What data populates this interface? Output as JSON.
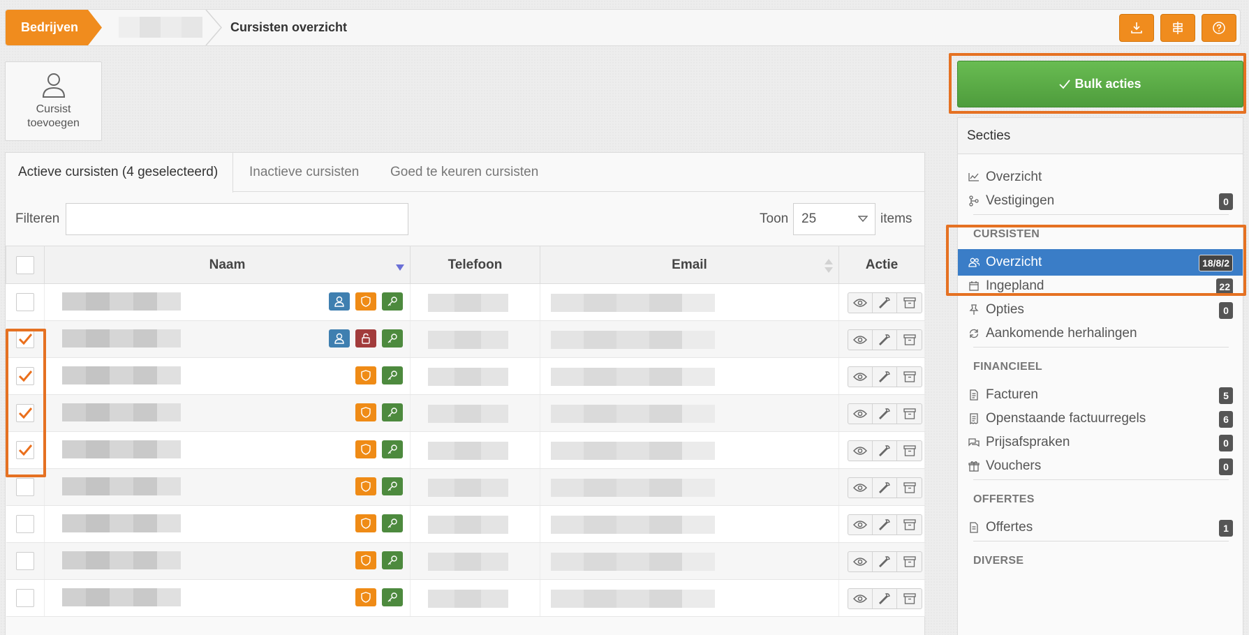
{
  "breadcrumb": {
    "home": "Bedrijven",
    "current": "Cursisten overzicht"
  },
  "toolbar": {
    "icons": [
      "download-icon",
      "signpost-icon",
      "help-icon"
    ]
  },
  "add_button": {
    "label": "Cursist toevoegen",
    "icon": "user-icon"
  },
  "tabs": [
    {
      "label": "Actieve cursisten (4 geselecteerd)",
      "active": true
    },
    {
      "label": "Inactieve cursisten",
      "active": false
    },
    {
      "label": "Goed te keuren cursisten",
      "active": false
    }
  ],
  "filter": {
    "label": "Filteren",
    "value": ""
  },
  "page_size": {
    "label": "Toon",
    "value": "25",
    "suffix": "items"
  },
  "table": {
    "headers": {
      "name": "Naam",
      "phone": "Telefoon",
      "email": "Email",
      "action": "Actie"
    },
    "rows": [
      {
        "checked": false,
        "badges": [
          "user",
          "shield",
          "key"
        ]
      },
      {
        "checked": true,
        "badges": [
          "user",
          "unlock",
          "key"
        ]
      },
      {
        "checked": true,
        "badges": [
          "shield",
          "key"
        ]
      },
      {
        "checked": true,
        "badges": [
          "shield",
          "key"
        ]
      },
      {
        "checked": true,
        "badges": [
          "shield",
          "key"
        ]
      },
      {
        "checked": false,
        "badges": [
          "shield",
          "key"
        ]
      },
      {
        "checked": false,
        "badges": [
          "shield",
          "key"
        ]
      },
      {
        "checked": false,
        "badges": [
          "shield",
          "key"
        ]
      },
      {
        "checked": false,
        "badges": [
          "shield",
          "key"
        ]
      }
    ]
  },
  "bulk": {
    "label": "Bulk acties"
  },
  "sidebar": {
    "title": "Secties",
    "items": [
      {
        "label": "Overzicht",
        "icon": "chart-icon"
      },
      {
        "label": "Vestigingen",
        "icon": "branch-icon",
        "count": "0"
      }
    ],
    "groups": [
      {
        "title": "CURSISTEN",
        "items": [
          {
            "label": "Overzicht",
            "icon": "users-icon",
            "count": "18/8/2",
            "active": true
          },
          {
            "label": "Ingepland",
            "icon": "calendar-icon",
            "count": "22"
          },
          {
            "label": "Opties",
            "icon": "pin-icon",
            "count": "0"
          },
          {
            "label": "Aankomende herhalingen",
            "icon": "refresh-icon"
          }
        ]
      },
      {
        "title": "FINANCIEEL",
        "items": [
          {
            "label": "Facturen",
            "icon": "invoice-icon",
            "count": "5"
          },
          {
            "label": "Openstaande factuurregels",
            "icon": "receipt-icon",
            "count": "6"
          },
          {
            "label": "Prijsafspraken",
            "icon": "chat-icon",
            "count": "0"
          },
          {
            "label": "Vouchers",
            "icon": "gift-icon",
            "count": "0"
          }
        ]
      },
      {
        "title": "OFFERTES",
        "items": [
          {
            "label": "Offertes",
            "icon": "document-icon",
            "count": "1"
          }
        ]
      },
      {
        "title": "DIVERSE",
        "items": []
      }
    ]
  },
  "colors": {
    "accent": "#f08c1e",
    "bulk": "#5eb24a",
    "active": "#3a7dc7",
    "highlight": "#e57122"
  }
}
